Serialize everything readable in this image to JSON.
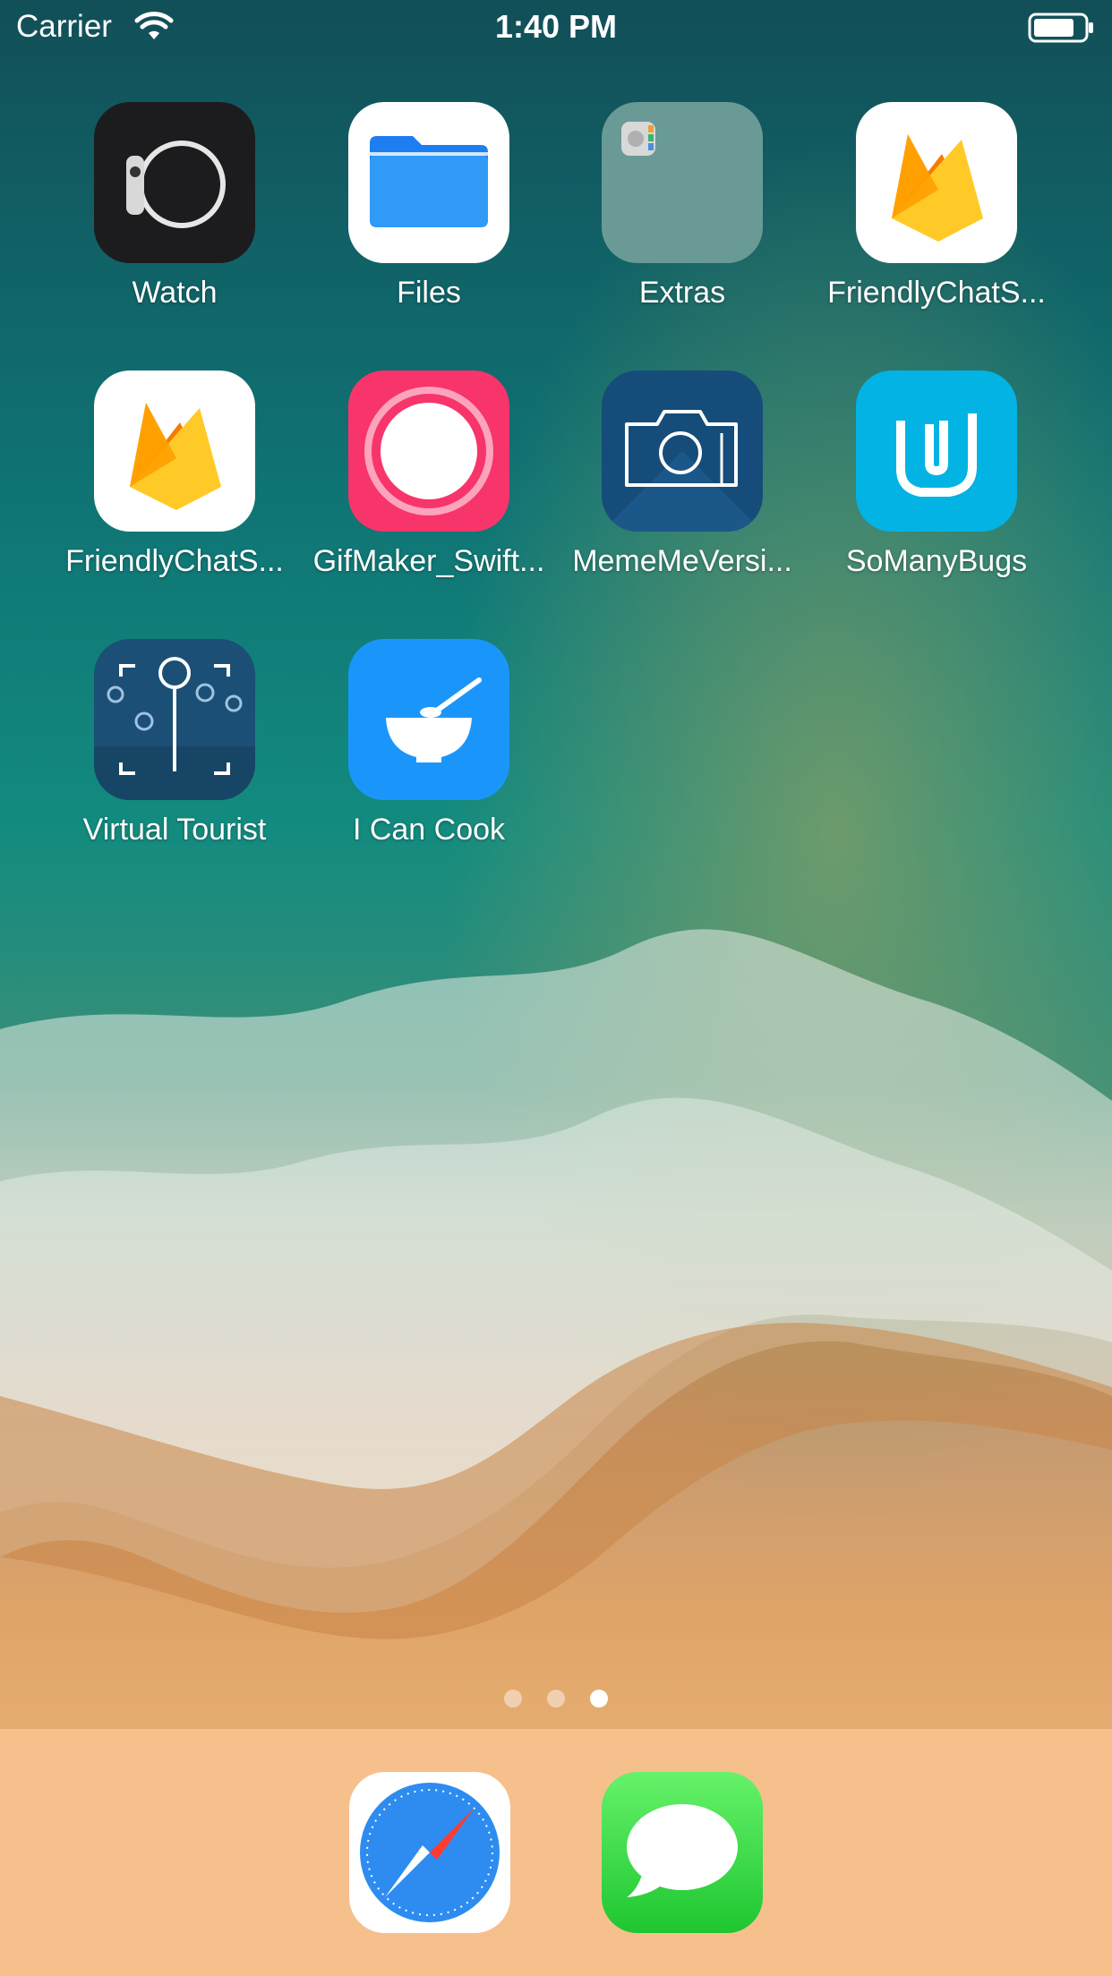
{
  "status_bar": {
    "carrier": "Carrier",
    "time": "1:40 PM",
    "wifi_icon": "wifi-icon",
    "battery_icon": "battery-icon"
  },
  "apps": [
    {
      "label": "Watch",
      "icon": "watch-icon"
    },
    {
      "label": "Files",
      "icon": "files-icon"
    },
    {
      "label": "Extras",
      "icon": "folder-icon"
    },
    {
      "label": "FriendlyChatS...",
      "icon": "firebase-icon"
    },
    {
      "label": "FriendlyChatS...",
      "icon": "firebase-icon"
    },
    {
      "label": "GifMaker_Swift...",
      "icon": "record-icon"
    },
    {
      "label": "MemeMeVersi...",
      "icon": "camera-icon"
    },
    {
      "label": "SoManyBugs",
      "icon": "udacity-icon"
    },
    {
      "label": "Virtual Tourist",
      "icon": "virtual-tourist-icon"
    },
    {
      "label": "I Can Cook",
      "icon": "bowl-icon"
    }
  ],
  "page_indicator": {
    "pages": 3,
    "current": 3
  },
  "dock": [
    {
      "icon": "safari-icon"
    },
    {
      "icon": "messages-icon"
    }
  ],
  "colors": {
    "dock_background": "#f6c08c",
    "ocean": "#0f6e70",
    "sand": "#e3a265"
  }
}
